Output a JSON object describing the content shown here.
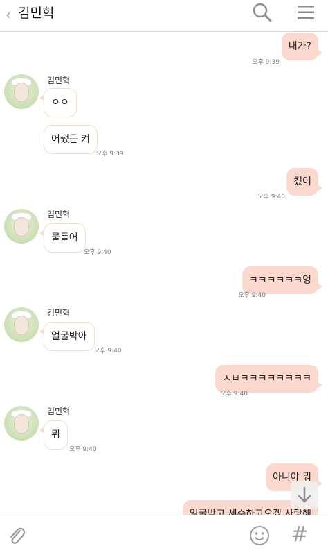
{
  "header": {
    "back_icon": "chevron-left-icon",
    "back_glyph": "‹",
    "title": "김민혁",
    "search_icon": "search-icon",
    "menu_icon": "hamburger-menu-icon"
  },
  "messages": [
    {
      "from": "me",
      "text": "내가?",
      "time": "오후 9:39"
    },
    {
      "from": "other",
      "sender": "김민혁",
      "text": "ㅇㅇ"
    },
    {
      "from": "other",
      "text": "어쨌든 켜",
      "time": "오후 9:39"
    },
    {
      "from": "me",
      "text": "켰어",
      "time": "오후 9:40"
    },
    {
      "from": "other",
      "sender": "김민혁",
      "text": "물틀어",
      "time": "오후 9:40"
    },
    {
      "from": "me",
      "text": "ㅋㅋㅋㅋㅋㅋ엉",
      "time": "오후 9:40"
    },
    {
      "from": "other",
      "sender": "김민혁",
      "text": "얼굴박아",
      "time": "오후 9:40"
    },
    {
      "from": "me",
      "text": "ㅅㅂㅋㅋㅋㅋㅋㅋㅋㅋ",
      "time": "오후 9:40"
    },
    {
      "from": "other",
      "sender": "김민혁",
      "text": "뭐",
      "time": "오후 9:40"
    },
    {
      "from": "me",
      "text": "아니야 뭐"
    },
    {
      "from": "me",
      "text": "얼굴박고 세수하고오겠 사랑해"
    }
  ],
  "bottom_bar": {
    "attach_icon": "paperclip-icon",
    "emoji_icon": "emoji-icon",
    "hash_glyph": "#"
  },
  "colors": {
    "my_bubble": "#fbd9cf",
    "other_bubble_border": "#f0e1c9",
    "avatar_bg": "#cfe1b8"
  }
}
